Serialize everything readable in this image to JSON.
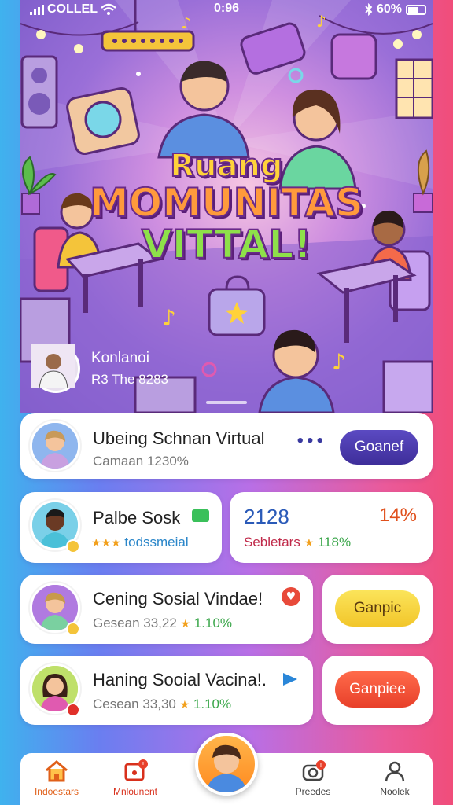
{
  "status_bar": {
    "carrier": "COLLEL",
    "time": "0:96",
    "battery": "60%"
  },
  "hero": {
    "title_line1": "Ruang",
    "title_line2": "MOMUNITAS",
    "title_line3": "VITTAL!",
    "host_name": "Konlanoi",
    "host_meta": "R3 The 8283"
  },
  "cards": {
    "card1": {
      "title": "Ubeing Schnan Virtual",
      "subtitle": "Camaan 1230%",
      "more": "•••",
      "button": "Goanef",
      "button_color": "#4b3aa8"
    },
    "card2": {
      "title": "Palbe Sosk",
      "subtitle": "todssmeial",
      "stars": "★★★"
    },
    "stats": {
      "number": "2128",
      "percent": "14%",
      "label": "Sebletars",
      "value": "118%"
    },
    "card3": {
      "title": "Cening Sosial Vindae!",
      "subtitle": "Gesean 33,22",
      "rating": "1.10%",
      "button": "Ganpic",
      "button_color": "#f2d43a"
    },
    "card4": {
      "title": "Haning Sooial Vacina!.",
      "subtitle": "Cesean 33,30",
      "rating": "1.10%",
      "button": "Ganpiee",
      "button_color": "#f04a32"
    }
  },
  "bottom_nav": [
    {
      "label": "Indoestars",
      "icon": "home-icon",
      "color": "#e0601a"
    },
    {
      "label": "Mnlounent",
      "icon": "image-notification-icon",
      "color": "#d8301c"
    },
    {
      "label": "Preedes",
      "icon": "camera-notification-icon",
      "color": "#444"
    },
    {
      "label": "Noolek",
      "icon": "profile-icon",
      "color": "#444"
    }
  ]
}
